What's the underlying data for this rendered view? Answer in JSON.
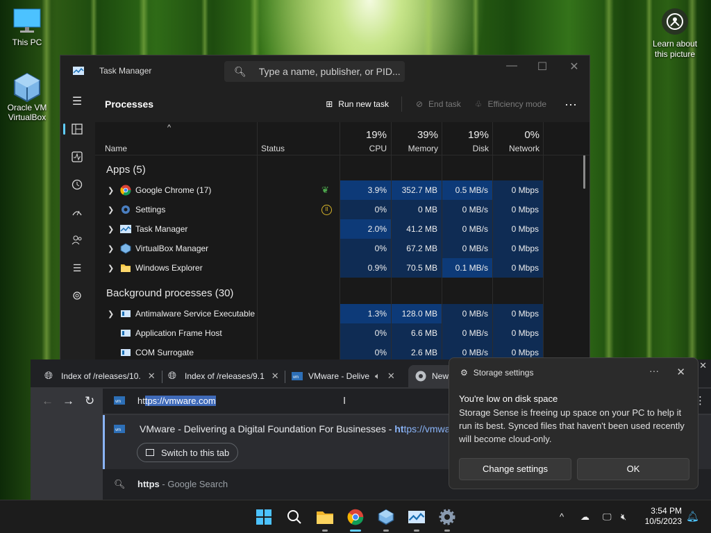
{
  "desktop": {
    "icons": [
      {
        "label": "This PC"
      },
      {
        "label": "Oracle VM VirtualBox"
      }
    ],
    "learn": {
      "label": "Learn about this picture"
    }
  },
  "taskmanager": {
    "title": "Task Manager",
    "search_placeholder": "Type a name, publisher, or PID...",
    "section": "Processes",
    "run_new_task": "Run new task",
    "end_task": "End task",
    "efficiency_mode": "Efficiency mode",
    "columns": {
      "name": "Name",
      "status": "Status",
      "cpu": {
        "pct": "19%",
        "label": "CPU"
      },
      "memory": {
        "pct": "39%",
        "label": "Memory"
      },
      "disk": {
        "pct": "19%",
        "label": "Disk"
      },
      "network": {
        "pct": "0%",
        "label": "Network"
      }
    },
    "apps_header": "Apps (5)",
    "apps": [
      {
        "name": "Google Chrome (17)",
        "cpu": "3.9%",
        "mem": "352.7 MB",
        "disk": "0.5 MB/s",
        "net": "0 Mbps",
        "status": "efficiency"
      },
      {
        "name": "Settings",
        "cpu": "0%",
        "mem": "0 MB",
        "disk": "0 MB/s",
        "net": "0 Mbps",
        "status": "suspended"
      },
      {
        "name": "Task Manager",
        "cpu": "2.0%",
        "mem": "41.2 MB",
        "disk": "0 MB/s",
        "net": "0 Mbps",
        "status": ""
      },
      {
        "name": "VirtualBox Manager",
        "cpu": "0%",
        "mem": "67.2 MB",
        "disk": "0 MB/s",
        "net": "0 Mbps",
        "status": ""
      },
      {
        "name": "Windows Explorer",
        "cpu": "0.9%",
        "mem": "70.5 MB",
        "disk": "0.1 MB/s",
        "net": "0 Mbps",
        "status": ""
      }
    ],
    "bg_header": "Background processes (30)",
    "background": [
      {
        "name": "Antimalware Service Executable",
        "cpu": "1.3%",
        "mem": "128.0 MB",
        "disk": "0 MB/s",
        "net": "0 Mbps"
      },
      {
        "name": "Application Frame Host",
        "cpu": "0%",
        "mem": "6.6 MB",
        "disk": "0 MB/s",
        "net": "0 Mbps"
      },
      {
        "name": "COM Surrogate",
        "cpu": "0%",
        "mem": "2.6 MB",
        "disk": "0 MB/s",
        "net": "0 Mbps"
      }
    ]
  },
  "chrome": {
    "tabs": [
      {
        "title": "Index of /releases/10."
      },
      {
        "title": "Index of /releases/9.1"
      },
      {
        "title": "VMware - Delive"
      },
      {
        "title": "New"
      }
    ],
    "url_prefix": "ht",
    "url_selected": "tps://vmware.com",
    "suggestion_title": "VMware - Delivering a Digital Foundation For Businesses",
    "suggestion_sep": " - ",
    "suggestion_url_bold": "ht",
    "suggestion_url_rest": "tps://vmwa",
    "switch_tab": "Switch to this tab",
    "search_query": "https",
    "search_suffix": " - Google Search"
  },
  "toast": {
    "app": "Storage settings",
    "title": "You're low on disk space",
    "body": "Storage Sense is freeing up space on your PC to help it run its best. Synced files that haven't been used recently will become cloud-only.",
    "change": "Change settings",
    "ok": "OK"
  },
  "taskbar": {
    "time": "3:54 PM",
    "date": "10/5/2023"
  }
}
